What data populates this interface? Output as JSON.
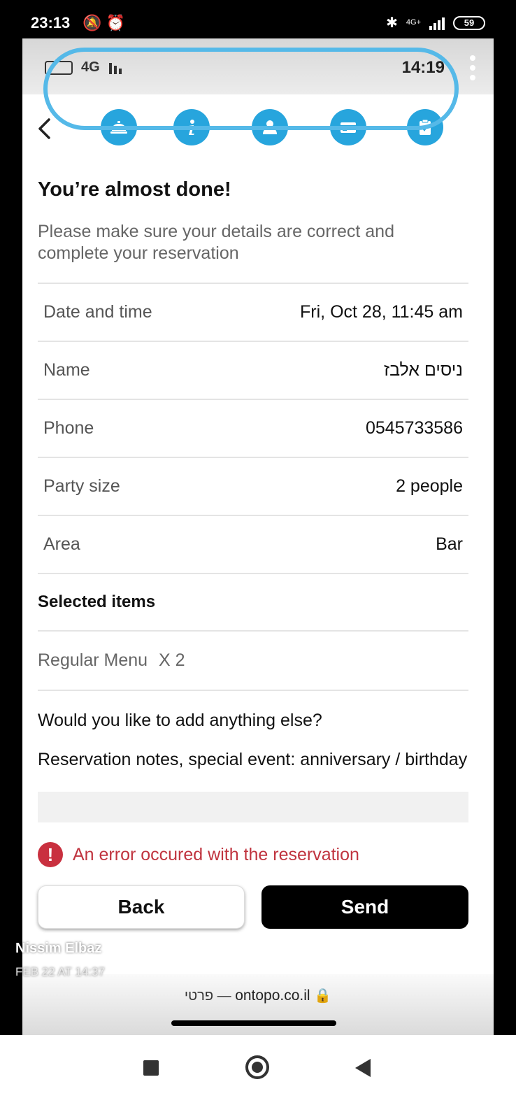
{
  "phone_status": {
    "time": "23:13",
    "left_icons": "🔕 ⏰",
    "network": "4G+",
    "battery": "59"
  },
  "inner_status": {
    "network": "4G",
    "time": "14:19"
  },
  "stepper": {
    "back_icon": "chevron-left-icon",
    "steps": [
      {
        "icon": "service-bell-icon"
      },
      {
        "icon": "info-icon"
      },
      {
        "icon": "person-icon"
      },
      {
        "icon": "credit-card-icon"
      },
      {
        "icon": "clipboard-check-icon"
      }
    ],
    "accent_color": "#27a5dd",
    "highlight_color": "#55b9e8"
  },
  "page": {
    "title": "You’re almost done!",
    "subtitle": "Please make sure your details are correct and complete your reservation"
  },
  "details": [
    {
      "label": "Date and time",
      "value": "Fri, Oct 28, 11:45 am"
    },
    {
      "label": "Name",
      "value": "ניסים אלבז"
    },
    {
      "label": "Phone",
      "value": "0545733586"
    },
    {
      "label": "Party size",
      "value": "2 people"
    },
    {
      "label": "Area",
      "value": "Bar"
    }
  ],
  "selected_items": {
    "title": "Selected items",
    "items": [
      {
        "name": "Regular Menu",
        "qty": "X  2"
      }
    ]
  },
  "additional": {
    "question": "Would you like to add anything else?",
    "notes_label": "Reservation notes, special event: anniversary / birthday",
    "notes_value": ""
  },
  "error": {
    "icon": "error-icon",
    "message": "An error occured with the reservation",
    "color": "#c0343f"
  },
  "buttons": {
    "back": "Back",
    "send": "Send"
  },
  "browser": {
    "url_prefix": "פרטי —",
    "host": "ontopo.co.il"
  },
  "overlay": {
    "name": "Nissim Elbaz",
    "date": "FEB 22 AT 14:37"
  }
}
